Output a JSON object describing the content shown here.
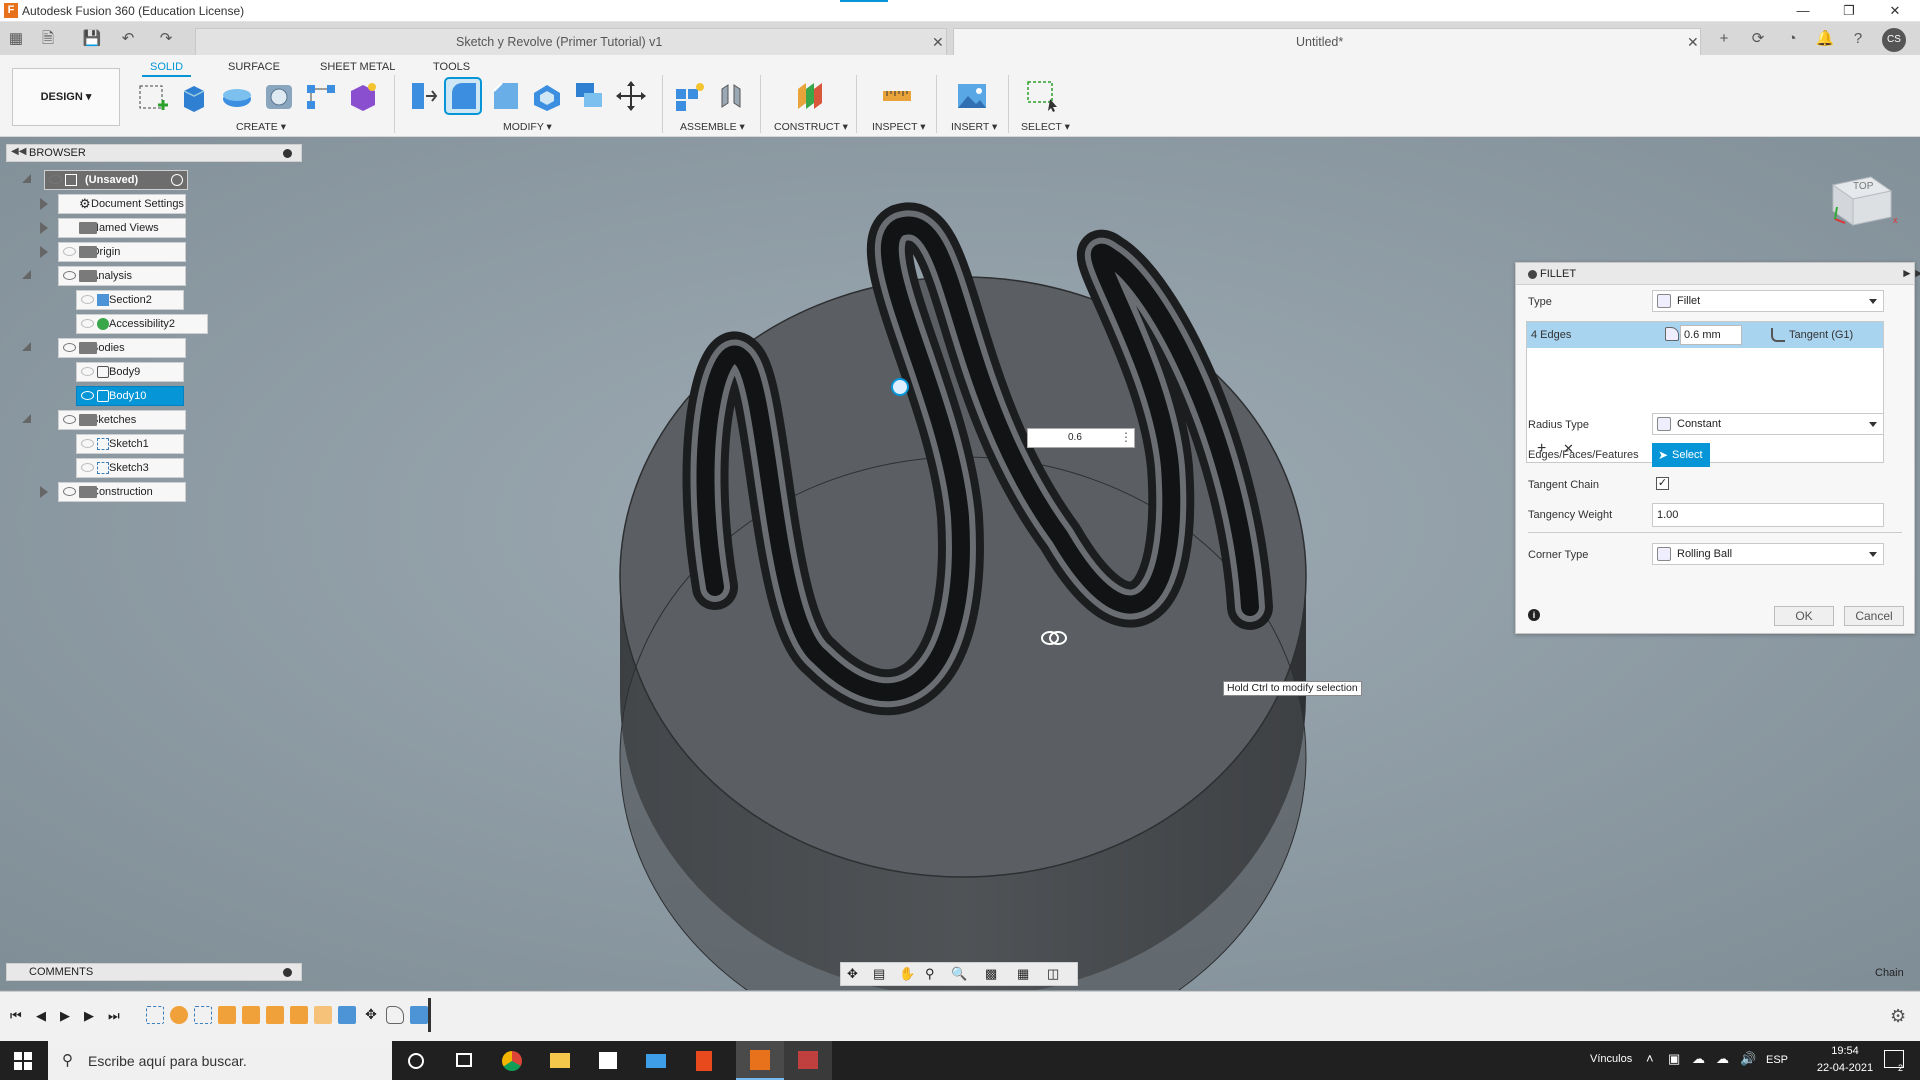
{
  "app": {
    "title": "Autodesk Fusion 360 (Education License)",
    "logo_letter": "F"
  },
  "tabs": [
    {
      "label": "Sketch y Revolve (Primer Tutorial) v1",
      "active": false
    },
    {
      "label": "Untitled*",
      "active": true
    }
  ],
  "user_initials": "CS",
  "workspace_tabs": [
    "SOLID",
    "SURFACE",
    "SHEET METAL",
    "TOOLS"
  ],
  "design_button": "DESIGN ▾",
  "tool_groups": {
    "create": "CREATE ▾",
    "modify": "MODIFY ▾",
    "assemble": "ASSEMBLE ▾",
    "construct": "CONSTRUCT ▾",
    "inspect": "INSPECT ▾",
    "insert": "INSERT ▾",
    "select": "SELECT ▾"
  },
  "browser": {
    "title": "BROWSER",
    "items": [
      {
        "label": "(Unsaved)"
      },
      {
        "label": "Document Settings"
      },
      {
        "label": "Named Views"
      },
      {
        "label": "Origin"
      },
      {
        "label": "Analysis"
      },
      {
        "label": "Section2"
      },
      {
        "label": "Accessibility2"
      },
      {
        "label": "Bodies"
      },
      {
        "label": "Body9"
      },
      {
        "label": "Body10"
      },
      {
        "label": "Sketches"
      },
      {
        "label": "Sketch1"
      },
      {
        "label": "Sketch3"
      },
      {
        "label": "Construction"
      }
    ]
  },
  "viewcube": {
    "face": "TOP"
  },
  "canvas": {
    "dimension_value": "0.6",
    "tooltip": "Hold Ctrl to modify selection"
  },
  "fillet": {
    "title": "FILLET",
    "type_label": "Type",
    "type_value": "Fillet",
    "row_edges": "4 Edges",
    "row_radius": "0.6 mm",
    "row_continuity": "Tangent (G1)",
    "radius_type_label": "Radius Type",
    "radius_type_value": "Constant",
    "edges_label": "Edges/Faces/Features",
    "select_button": "Select",
    "tangent_chain_label": "Tangent Chain",
    "tangency_weight_label": "Tangency Weight",
    "tangency_weight_value": "1.00",
    "corner_type_label": "Corner Type",
    "corner_type_value": "Rolling Ball",
    "ok": "OK",
    "cancel": "Cancel"
  },
  "comments": "COMMENTS",
  "chain_label": "Chain",
  "taskbar": {
    "search_placeholder": "Escribe aquí para buscar.",
    "links": "Vínculos",
    "lang": "ESP",
    "time": "19:54",
    "date": "22-04-2021",
    "notifications": "2"
  }
}
